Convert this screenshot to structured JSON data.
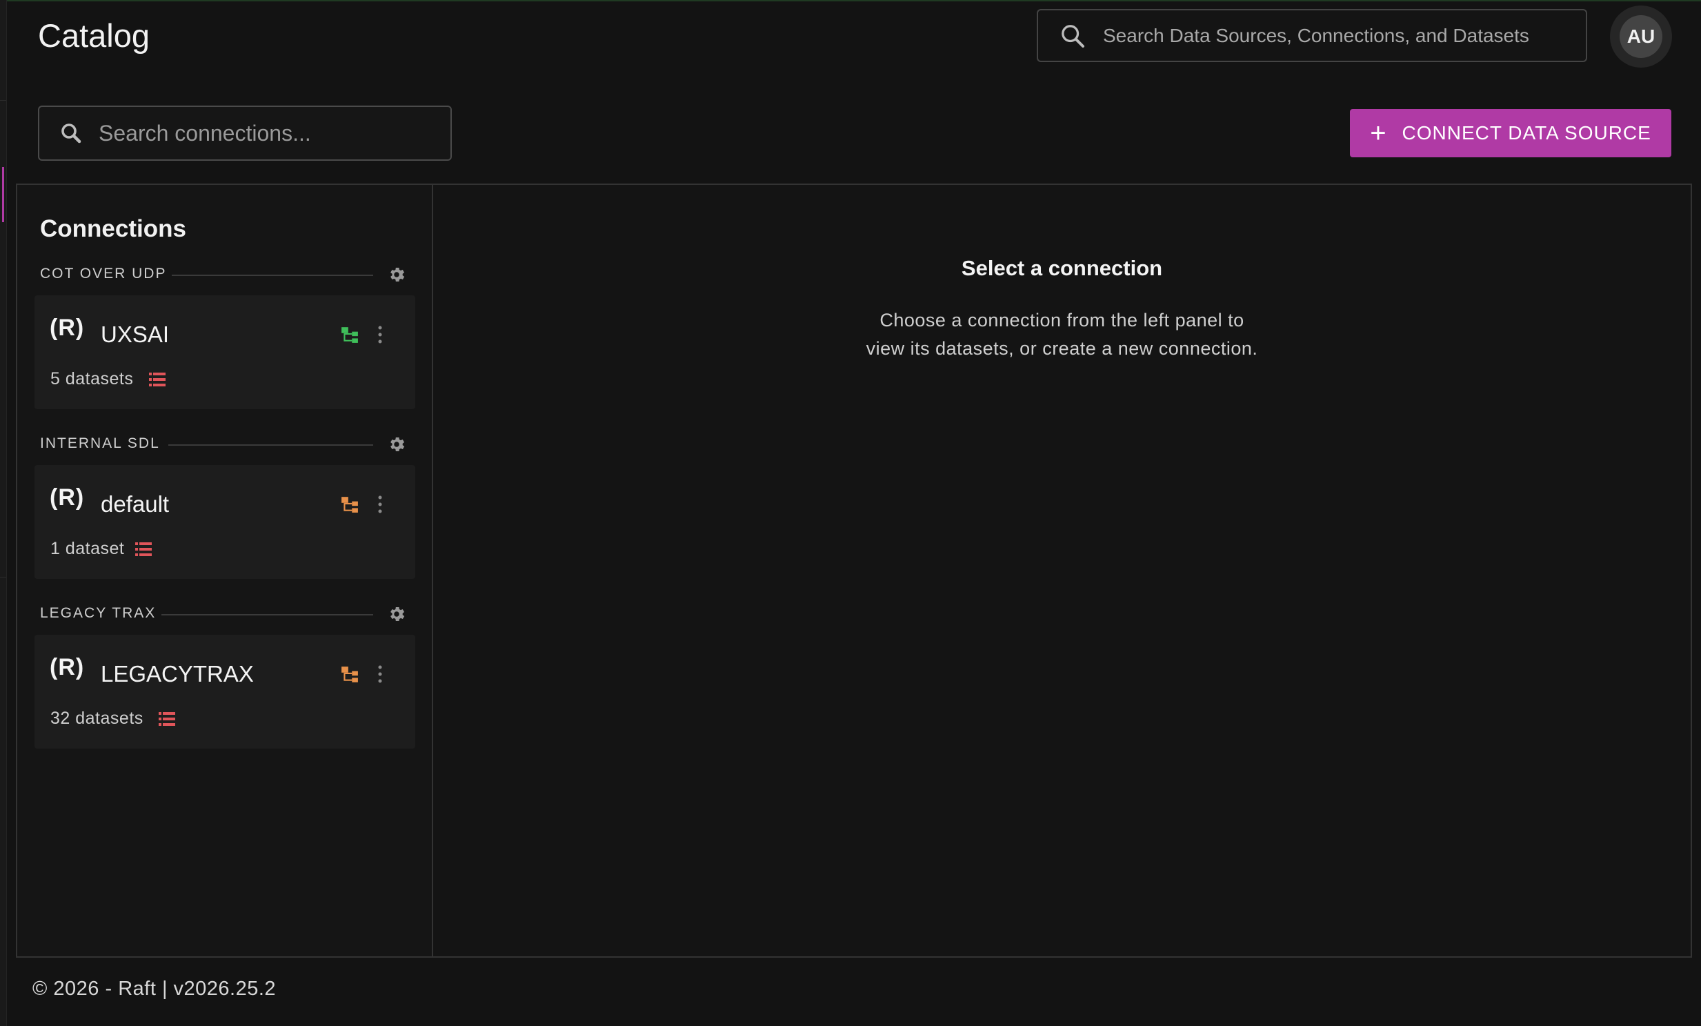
{
  "header": {
    "title": "Catalog",
    "global_search_placeholder": "Search Data Sources, Connections, and Datasets",
    "avatar_initials": "AU"
  },
  "toolbar": {
    "connection_search_placeholder": "Search connections...",
    "connect_button_label": "CONNECT DATA SOURCE",
    "accent_color": "#b03aa5"
  },
  "connections_panel": {
    "heading": "Connections",
    "groups": [
      {
        "label": "COT OVER UDP",
        "connection": {
          "logo": "(R)",
          "name": "UXSAI",
          "datasets_label": "5 datasets",
          "status_color": "#3fbf5a"
        }
      },
      {
        "label": "INTERNAL SDL",
        "connection": {
          "logo": "(R)",
          "name": "default",
          "datasets_label": "1 dataset",
          "status_color": "#e8914a"
        }
      },
      {
        "label": "LEGACY TRAX",
        "connection": {
          "logo": "(R)",
          "name": "LEGACYTRAX",
          "datasets_label": "32 datasets",
          "status_color": "#e8914a"
        }
      }
    ]
  },
  "detail_panel": {
    "empty_title": "Select a connection",
    "empty_line1": "Choose a connection from the left panel to",
    "empty_line2": "view its datasets, or create a new connection."
  },
  "footer": {
    "text": "© 2026 - Raft  | v2026.25.2"
  }
}
